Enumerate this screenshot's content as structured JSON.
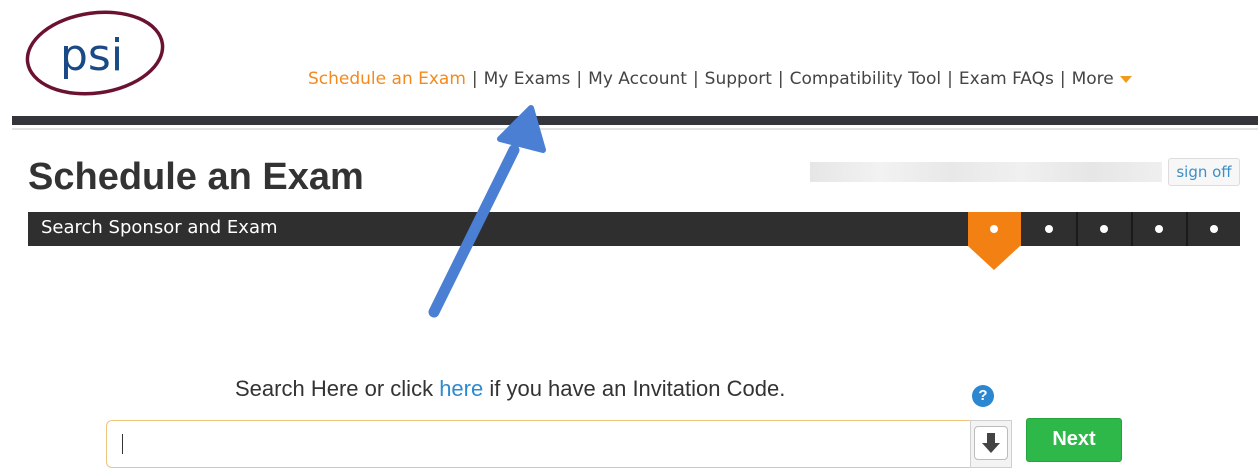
{
  "brand": {
    "logo_text": "psi",
    "logo_color": "#6b1233",
    "logo_text_color": "#1a4a85"
  },
  "nav": {
    "items": [
      {
        "label": "Schedule an Exam",
        "active": true
      },
      {
        "label": "My Exams"
      },
      {
        "label": "My Account"
      },
      {
        "label": "Support"
      },
      {
        "label": "Compatibility Tool"
      },
      {
        "label": "Exam FAQs"
      },
      {
        "label": "More"
      }
    ],
    "separator": "|",
    "active_color": "#f28a1e"
  },
  "page": {
    "title": "Schedule an Exam"
  },
  "user": {
    "signoff_label": "sign off"
  },
  "wizard": {
    "step_label": "Search Sponsor and Exam",
    "current_step": 1,
    "total_steps": 5,
    "active_color": "#f28012"
  },
  "search": {
    "prompt_before": "Search Here or click ",
    "link_text": "here",
    "prompt_after": " if you have an Invitation Code.",
    "help_label": "?",
    "input_value": "",
    "next_label": "Next"
  },
  "annotation": {
    "arrow_color": "#4a7fd4",
    "target": "My Exams"
  }
}
